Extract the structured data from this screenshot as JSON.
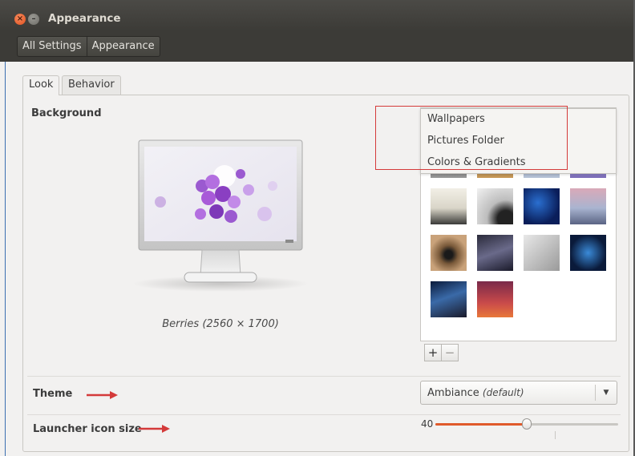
{
  "window": {
    "title": "Appearance",
    "close_symbol": "×",
    "minimize_symbol": "–"
  },
  "breadcrumbs": [
    "All Settings",
    "Appearance"
  ],
  "tabs": [
    {
      "label": "Look",
      "active": true
    },
    {
      "label": "Behavior",
      "active": false
    }
  ],
  "background": {
    "label": "Background",
    "current_caption": "Berries (2560 × 1700)"
  },
  "source_menu": {
    "items": [
      "Wallpapers",
      "Pictures Folder",
      "Colors & Gradients"
    ]
  },
  "gallery_buttons": {
    "add": "+",
    "remove": "−"
  },
  "theme": {
    "label": "Theme",
    "value": "Ambiance",
    "default_note": "(default)"
  },
  "launcher": {
    "label": "Launcher icon size",
    "value": "40",
    "slider_fraction": 0.5
  },
  "colors": {
    "accent": "#e05a2b",
    "annotation_red": "#d43a3a"
  }
}
